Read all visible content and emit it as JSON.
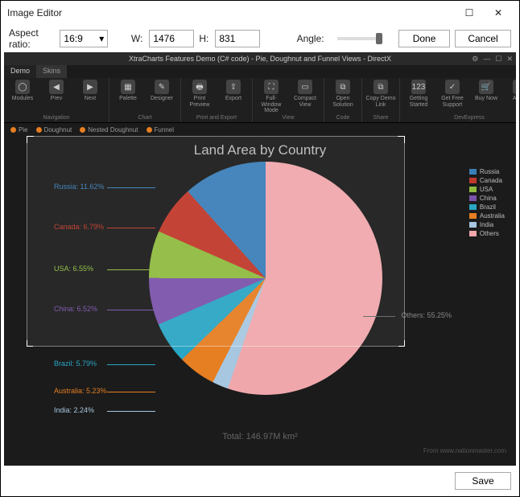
{
  "window": {
    "title": "Image Editor"
  },
  "toolbar": {
    "aspect_label": "Aspect ratio:",
    "aspect_value": "16:9",
    "w_label": "W:",
    "w_value": "1476",
    "h_label": "H:",
    "h_value": "831",
    "angle_label": "Angle:",
    "done": "Done",
    "cancel": "Cancel"
  },
  "demo": {
    "header": "XtraCharts Features Demo (C# code) - Pie, Doughnut and Funnel Views - DirectX",
    "tabs": [
      "Demo",
      "Skins"
    ]
  },
  "ribbon": {
    "groups": [
      {
        "label": "Navigation",
        "items": [
          {
            "icon": "◯",
            "label": "Modules"
          },
          {
            "icon": "◀",
            "label": "Prev"
          },
          {
            "icon": "▶",
            "label": "Next"
          }
        ]
      },
      {
        "label": "Chart",
        "items": [
          {
            "icon": "▦",
            "label": "Palette"
          },
          {
            "icon": "✎",
            "label": "Designer"
          }
        ]
      },
      {
        "label": "Print and Export",
        "items": [
          {
            "icon": "🖶",
            "label": "Print Preview"
          },
          {
            "icon": "⇪",
            "label": "Export"
          }
        ]
      },
      {
        "label": "View",
        "items": [
          {
            "icon": "⛶",
            "label": "Full-Window Mode"
          },
          {
            "icon": "▭",
            "label": "Compact View"
          }
        ]
      },
      {
        "label": "Code",
        "items": [
          {
            "icon": "⧉",
            "label": "Open Solution"
          }
        ]
      },
      {
        "label": "Share",
        "items": [
          {
            "icon": "⧉",
            "label": "Copy Demo Link"
          }
        ]
      },
      {
        "label": "DevExpress",
        "items": [
          {
            "icon": "123",
            "label": "Getting Started"
          },
          {
            "icon": "✓",
            "label": "Get Free Support"
          },
          {
            "icon": "🛒",
            "label": "Buy Now"
          },
          {
            "icon": "ⓘ",
            "label": "About"
          }
        ]
      }
    ],
    "view_tabs": [
      {
        "label": "Pie",
        "color": "#e67e22"
      },
      {
        "label": "Doughnut",
        "color": "#e67e22"
      },
      {
        "label": "Nested Doughnut",
        "color": "#e67e22"
      },
      {
        "label": "Funnel",
        "color": "#e67e22"
      }
    ]
  },
  "chart_data": {
    "type": "pie",
    "title": "Land Area by Country",
    "total_label": "Total: 146.97M km²",
    "credit": "From www.nationmaster.com",
    "series": [
      {
        "name": "Russia",
        "value": 11.62,
        "color": "#3b7fb8",
        "label": "Russia: 11.62%"
      },
      {
        "name": "Canada",
        "value": 6.79,
        "color": "#c0392b",
        "label": "Canada: 6.79%"
      },
      {
        "name": "USA",
        "value": 6.55,
        "color": "#8fbc3f",
        "label": "USA: 6.55%"
      },
      {
        "name": "China",
        "value": 6.52,
        "color": "#7b52ab",
        "label": "China: 6.52%"
      },
      {
        "name": "Brazil",
        "value": 5.79,
        "color": "#2aa5c4",
        "label": "Brazil: 5.79%"
      },
      {
        "name": "Australia",
        "value": 5.23,
        "color": "#e67e22",
        "label": "Australia: 5.23%"
      },
      {
        "name": "India",
        "value": 2.24,
        "color": "#a7c7e0",
        "label": "India: 2.24%"
      },
      {
        "name": "Others",
        "value": 55.25,
        "color": "#f0a7ac",
        "label": "Others: 55.25%"
      }
    ]
  },
  "footer": {
    "save": "Save"
  }
}
